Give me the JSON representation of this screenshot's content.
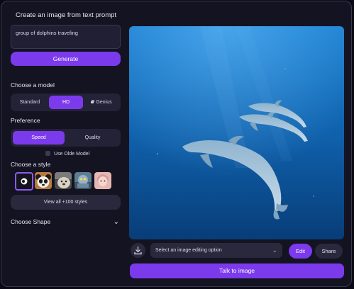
{
  "app": {
    "title": "Create an image from text prompt"
  },
  "prompt": {
    "value": "group of dolphins traveling"
  },
  "generate": {
    "label": "Generate"
  },
  "model": {
    "label": "Choose a model",
    "options": [
      "Standard",
      "HD",
      "Genius"
    ],
    "selected": "HD"
  },
  "preference": {
    "label": "Preference",
    "options": [
      "Speed",
      "Quality"
    ],
    "selected": "Speed",
    "olde_label": "Use Olde Model"
  },
  "style": {
    "label": "Choose a style",
    "thumbnails": [
      "style-selected-icon",
      "panda-style",
      "bear-style",
      "robot-style",
      "portrait-style"
    ],
    "view_all": "View all +100 styles"
  },
  "shape": {
    "label": "Choose Shape"
  },
  "image": {
    "description_icon": "dolphins-image"
  },
  "editing": {
    "placeholder": "Select an image editing option",
    "edit_label": "Edit",
    "share_label": "Share",
    "talk_label": "Talk to image"
  },
  "colors": {
    "accent": "#7c3aed",
    "background": "#141322",
    "panel": "#242236"
  }
}
